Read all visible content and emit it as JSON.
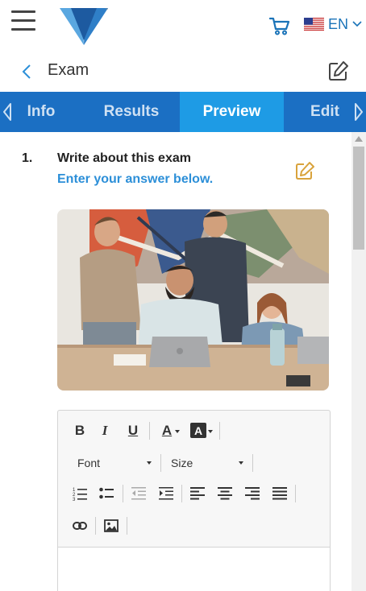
{
  "header": {
    "language": "EN",
    "icons": {
      "menu": "hamburger-menu-icon",
      "logo": "v-logo",
      "cart": "cart-icon",
      "flag": "us-flag-icon",
      "caret": "chevron-down-icon"
    },
    "colors": {
      "brand_blue": "#1a73b8",
      "logo_light": "#5aa7e0",
      "logo_dark": "#1d5aa0"
    }
  },
  "subheader": {
    "title": "Exam",
    "icons": {
      "back": "chevron-left-icon",
      "edit": "edit-icon"
    }
  },
  "tabs": {
    "items": [
      {
        "label": "Info",
        "active": false
      },
      {
        "label": "Results",
        "active": false
      },
      {
        "label": "Preview",
        "active": true
      },
      {
        "label": "Edit",
        "active": false
      }
    ],
    "colors": {
      "bar": "#1b6fc3",
      "active": "#1e9be5"
    }
  },
  "question": {
    "number": "1.",
    "title": "Write about this exam",
    "subtitle": "Enter your answer below.",
    "accent_color": "#d9a33c",
    "image": "team-photo"
  },
  "editor": {
    "buttons": {
      "bold": "B",
      "italic": "I",
      "underline": "U",
      "font_color": "A",
      "highlight": "A"
    },
    "font_select": "Font",
    "size_select": "Size",
    "icons": [
      "ordered-list-icon",
      "unordered-list-icon",
      "outdent-icon",
      "indent-icon",
      "align-left-icon",
      "align-center-icon",
      "align-right-icon",
      "justify-icon",
      "link-icon",
      "image-icon"
    ]
  }
}
